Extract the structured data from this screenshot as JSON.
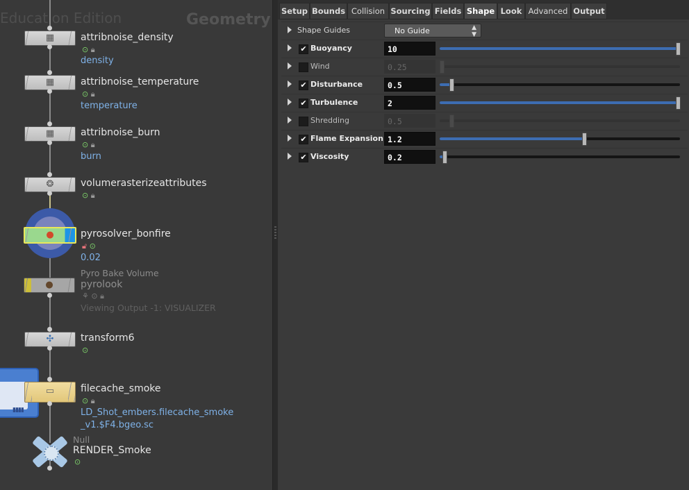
{
  "network": {
    "watermark": "Education Edition",
    "context_label": "Geometry",
    "nodes": [
      {
        "name": "attribnoise_density",
        "sub": "density"
      },
      {
        "name": "attribnoise_temperature",
        "sub": "temperature"
      },
      {
        "name": "attribnoise_burn",
        "sub": "burn"
      },
      {
        "name": "volumerasterizeattributes",
        "sub": ""
      },
      {
        "name": "pyrosolver_bonfire",
        "sub": "0.02"
      },
      {
        "name": "pyrolook",
        "type_label": "Pyro Bake Volume",
        "sub": "Viewing Output -1: VISUALIZER"
      },
      {
        "name": "transform6",
        "sub": ""
      },
      {
        "name": "filecache_smoke",
        "sub": "LD_Shot_embers.filecache_smoke",
        "sub2": "_v1.$F4.bgeo.sc"
      },
      {
        "name": "RENDER_Smoke",
        "type_label": "Null"
      }
    ]
  },
  "params": {
    "tabs": [
      "Setup",
      "Bounds",
      "Collision",
      "Sourcing",
      "Fields",
      "Shape",
      "Look",
      "Advanced",
      "Output"
    ],
    "active_tab": "Shape",
    "shape_guides": {
      "label": "Shape Guides",
      "value": "No Guide"
    },
    "rows": [
      {
        "label": "Buoyancy",
        "value": "10",
        "enabled": true,
        "level": 1.0
      },
      {
        "label": "Wind",
        "value": "0.25",
        "enabled": false,
        "level": 0.0
      },
      {
        "label": "Disturbance",
        "value": "0.5",
        "enabled": true,
        "level": 0.05
      },
      {
        "label": "Turbulence",
        "value": "2",
        "enabled": true,
        "level": 1.0
      },
      {
        "label": "Shredding",
        "value": "0.5",
        "enabled": false,
        "level": 0.05
      },
      {
        "label": "Flame Expansion",
        "value": "1.2",
        "enabled": true,
        "level": 0.6
      },
      {
        "label": "Viscosity",
        "value": "0.2",
        "enabled": true,
        "level": 0.02
      }
    ]
  },
  "colors": {
    "accent": "#3d6db2",
    "link": "#7fb2e8",
    "flag_green": "#7ed36a"
  }
}
